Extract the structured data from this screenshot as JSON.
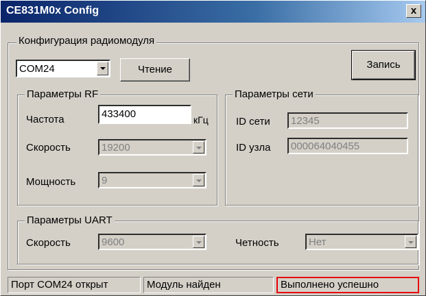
{
  "window": {
    "title": "CE831M0x Config",
    "close_symbol": "x"
  },
  "config_group": {
    "legend": "Конфигурация радиомодуля",
    "port_select": "COM24",
    "read_button": "Чтение",
    "write_button": "Запись"
  },
  "rf_group": {
    "legend": "Параметры RF",
    "frequency_label": "Частота",
    "frequency_value": "433400",
    "frequency_unit": "кГц",
    "speed_label": "Скорость",
    "speed_value": "19200",
    "power_label": "Мощность",
    "power_value": "9"
  },
  "net_group": {
    "legend": "Параметры сети",
    "net_id_label": "ID сети",
    "net_id_value": "12345",
    "node_id_label": "ID узла",
    "node_id_value": "000064040455"
  },
  "uart_group": {
    "legend": "Параметры UART",
    "speed_label": "Скорость",
    "speed_value": "9600",
    "parity_label": "Четность",
    "parity_value": "Нет"
  },
  "statusbar": {
    "port_status": "Порт COM24 открыт",
    "module_status": "Модуль найден",
    "result_status": "Выполнено успешно"
  },
  "colors": {
    "result_border": "#e8000b",
    "titlebar": "#0a246a"
  }
}
